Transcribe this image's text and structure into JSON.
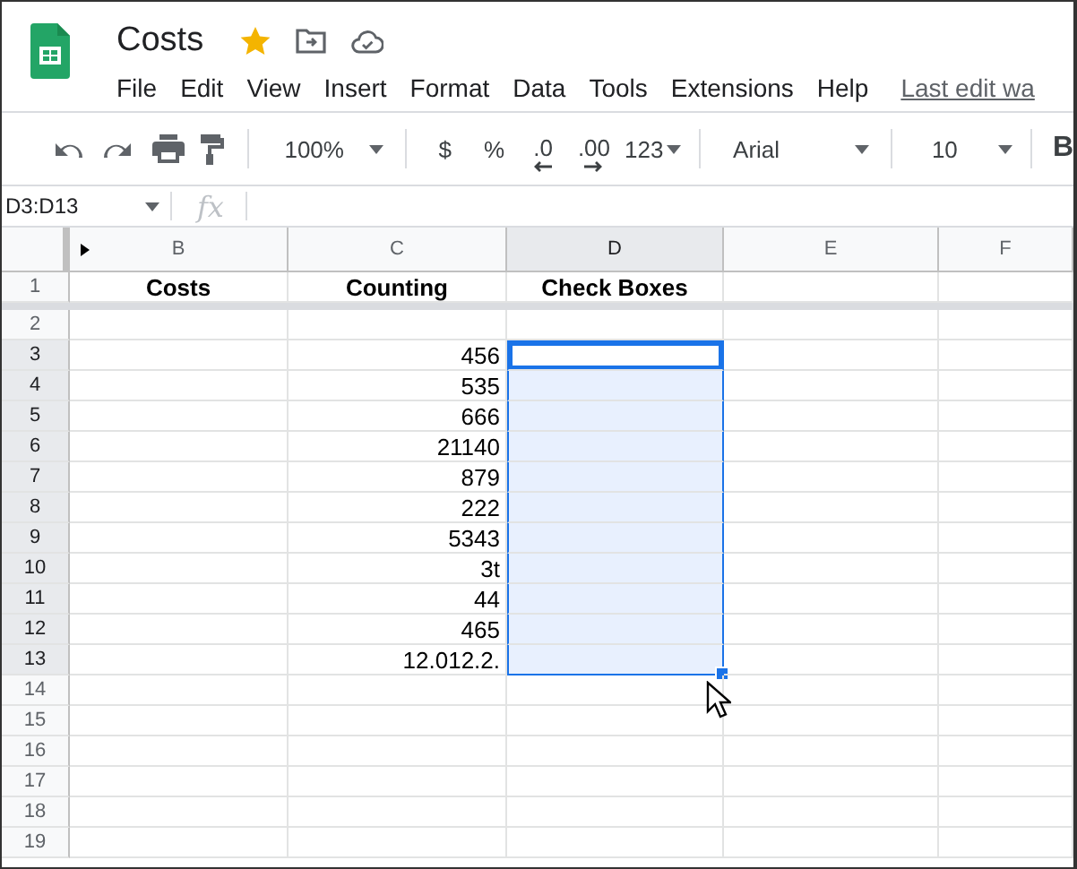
{
  "app": {
    "title": "Costs",
    "starred": true
  },
  "menu": [
    "File",
    "Edit",
    "View",
    "Insert",
    "Format",
    "Data",
    "Tools",
    "Extensions",
    "Help"
  ],
  "last_edit": "Last edit wa",
  "toolbar": {
    "zoom": "100%",
    "currency": "$",
    "percent": "%",
    "decrease_decimal": ".0",
    "increase_decimal": ".00",
    "number_format": "123",
    "font": "Arial",
    "font_size": "10",
    "bold": "B"
  },
  "formula_bar": {
    "name_box": "D3:D13",
    "fx": "fx"
  },
  "columns": [
    {
      "label": "B",
      "selected": false
    },
    {
      "label": "C",
      "selected": false
    },
    {
      "label": "D",
      "selected": true
    },
    {
      "label": "E",
      "selected": false
    },
    {
      "label": "F",
      "selected": false
    }
  ],
  "header_row": {
    "number": "1",
    "cells": [
      "Costs",
      "Counting",
      "Check Boxes"
    ]
  },
  "rows": [
    {
      "number": "2",
      "selected": false,
      "active": false
    },
    {
      "number": "3",
      "selected": true,
      "active": true,
      "counting": "456"
    },
    {
      "number": "4",
      "selected": true,
      "active": false,
      "counting": "535"
    },
    {
      "number": "5",
      "selected": true,
      "active": false,
      "counting": "666"
    },
    {
      "number": "6",
      "selected": true,
      "active": false,
      "counting": "21140"
    },
    {
      "number": "7",
      "selected": true,
      "active": false,
      "counting": "879"
    },
    {
      "number": "8",
      "selected": true,
      "active": false,
      "counting": "222"
    },
    {
      "number": "9",
      "selected": true,
      "active": false,
      "counting": "5343"
    },
    {
      "number": "10",
      "selected": true,
      "active": false,
      "counting": "3t"
    },
    {
      "number": "11",
      "selected": true,
      "active": false,
      "counting": "44"
    },
    {
      "number": "12",
      "selected": true,
      "active": false,
      "counting": "465"
    },
    {
      "number": "13",
      "selected": true,
      "active": false,
      "counting": "12.012.2."
    },
    {
      "number": "14",
      "selected": false,
      "active": false
    },
    {
      "number": "15",
      "selected": false,
      "active": false
    },
    {
      "number": "16",
      "selected": false,
      "active": false
    },
    {
      "number": "17",
      "selected": false,
      "active": false
    },
    {
      "number": "18",
      "selected": false,
      "active": false
    },
    {
      "number": "19",
      "selected": false,
      "active": false
    }
  ]
}
